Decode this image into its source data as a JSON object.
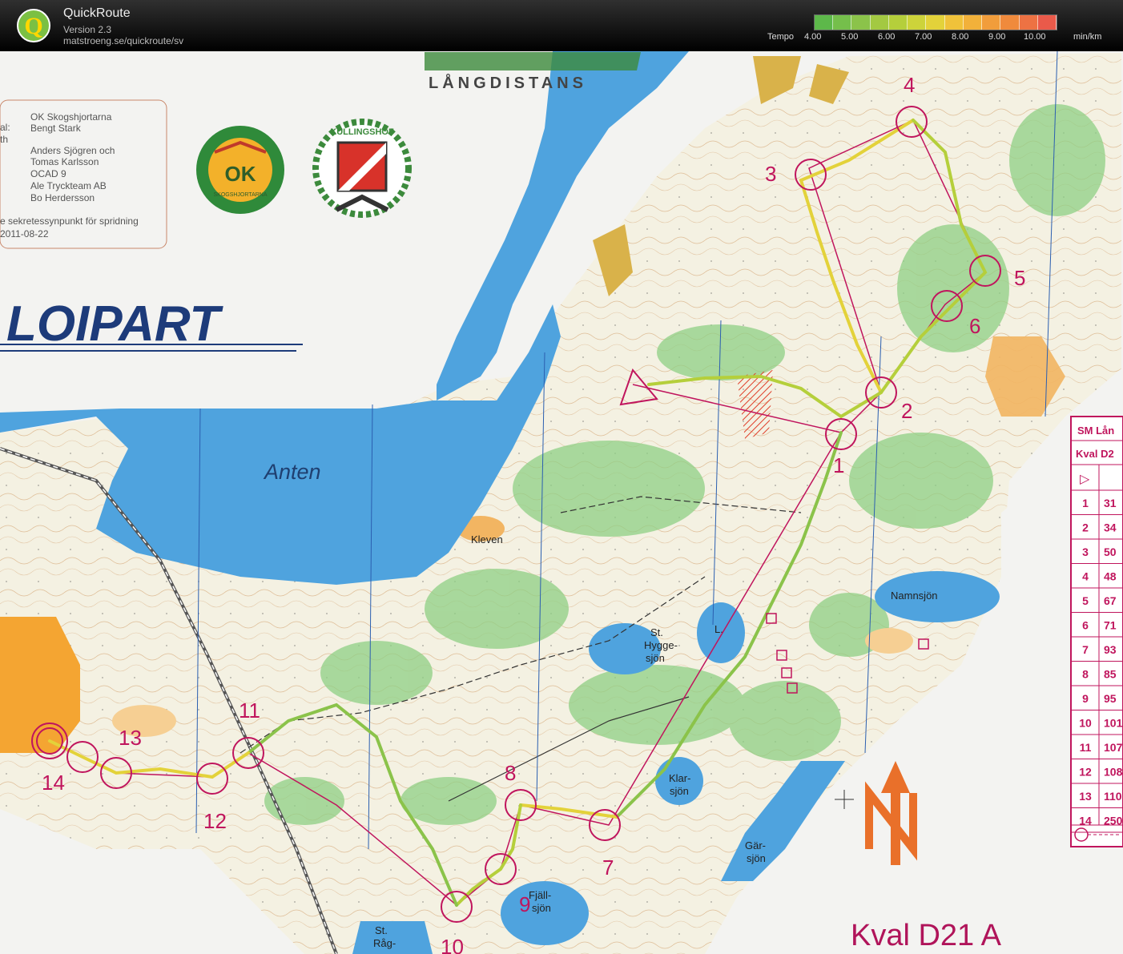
{
  "app": {
    "title": "QuickRoute",
    "version": "Version 2.3",
    "url": "matstroeng.se/quickroute/sv"
  },
  "tempo_scale": {
    "label": "Tempo",
    "ticks": [
      "4.00",
      "5.00",
      "6.00",
      "7.00",
      "8.00",
      "9.00",
      "10.00"
    ],
    "unit": "min/km",
    "colors": [
      "#5db84a",
      "#8bc34a",
      "#b5cf3b",
      "#e3d23a",
      "#f2b13a",
      "#f08a3c",
      "#ea5a4a"
    ]
  },
  "map": {
    "event_heading": "LÅNGDISTANS",
    "banner_text": "LOIPART",
    "credits": [
      {
        "label": "al:",
        "value": "OK Skogshjortarna"
      },
      {
        "label": "",
        "value": "Bengt Stark"
      },
      {
        "label": "th",
        "value": "Anders Sjögren och"
      },
      {
        "label": "",
        "value": "Tomas Karlsson"
      },
      {
        "label": "",
        "value": "OCAD 9"
      },
      {
        "label": "",
        "value": "Ale Tryckteam AB"
      },
      {
        "label": "",
        "value": "Bo Herdersson"
      }
    ],
    "credit_note": "e sekretessynpunkt för spridning",
    "credit_date": "2011-08-22",
    "logo1_text": "SKOGSHJORTARNA",
    "logo1_initials": "OK",
    "logo2_text": "KULLINGSHOF",
    "lakes": {
      "anten": "Anten",
      "namnsjon": "Namnsjön",
      "hyggesjon_1": "St.",
      "hyggesjon_2": "Hygge-",
      "hyggesjon_3": "sjön",
      "l": "L.",
      "klarsjon_1": "Klar-",
      "klarsjon_2": "sjön",
      "garsjon_1": "Gär-",
      "garsjon_2": "sjön",
      "fjallsjon_1": "Fjäll-",
      "fjallsjon_2": "sjön",
      "ragsjon_1": "St.",
      "ragsjon_2": "Råg-"
    },
    "place_kleven": "Kleven",
    "course_label": "Kval D21 A",
    "control_numbers": [
      "1",
      "2",
      "3",
      "4",
      "5",
      "6",
      "7",
      "8",
      "9",
      "10",
      "11",
      "12",
      "13",
      "14"
    ],
    "table": {
      "header1": "SM Lån",
      "header2": "Kval D2",
      "start_symbol": "▷",
      "rows": [
        {
          "n": "1",
          "code": "31"
        },
        {
          "n": "2",
          "code": "34"
        },
        {
          "n": "3",
          "code": "50"
        },
        {
          "n": "4",
          "code": "48"
        },
        {
          "n": "5",
          "code": "67"
        },
        {
          "n": "6",
          "code": "71"
        },
        {
          "n": "7",
          "code": "93"
        },
        {
          "n": "8",
          "code": "85"
        },
        {
          "n": "9",
          "code": "95"
        },
        {
          "n": "10",
          "code": "101"
        },
        {
          "n": "11",
          "code": "107"
        },
        {
          "n": "12",
          "code": "108"
        },
        {
          "n": "13",
          "code": "110"
        },
        {
          "n": "14",
          "code": "250"
        }
      ]
    }
  }
}
